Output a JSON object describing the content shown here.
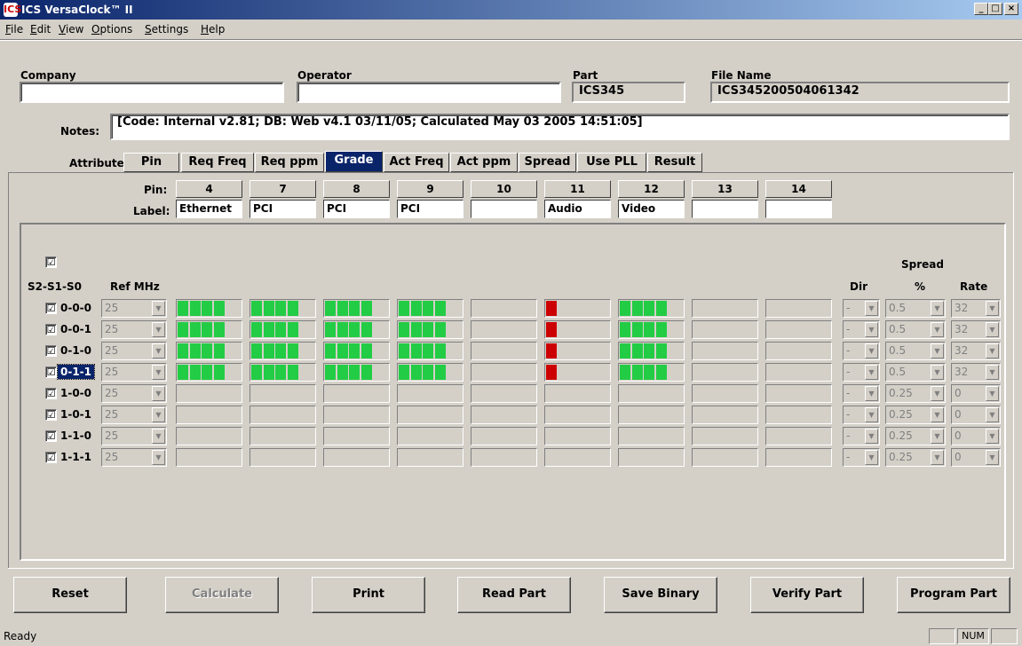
{
  "window": {
    "title": "ICS VersaClock™ II",
    "min": "_",
    "max": "□",
    "close": "×",
    "icon": "ICS"
  },
  "menu": [
    "File",
    "Edit",
    "View",
    "Options",
    "Settings",
    "Help"
  ],
  "header": {
    "company_label": "Company",
    "company_value": "",
    "operator_label": "Operator",
    "operator_value": "",
    "part_label": "Part",
    "part_value": "ICS345",
    "filename_label": "File Name",
    "filename_value": "ICS345200504061342",
    "notes_label": "Notes:",
    "notes_value": "[Code: Internal v2.81; DB: Web v4.1 03/11/05; Calculated May 03 2005 14:51:05]"
  },
  "attributes": {
    "label": "Attribute:",
    "tabs": [
      "Pin",
      "Req Freq",
      "Req ppm",
      "Grade",
      "Act Freq",
      "Act ppm",
      "Spread",
      "Use PLL",
      "Result"
    ],
    "active": "Grade"
  },
  "pins": {
    "pin_label": "Pin:",
    "label_label": "Label:",
    "numbers": [
      "4",
      "7",
      "8",
      "9",
      "10",
      "11",
      "12",
      "13",
      "14"
    ],
    "labels": [
      "Ethernet",
      "PCI",
      "PCI",
      "PCI",
      "",
      "Audio",
      "Video",
      "",
      ""
    ]
  },
  "grid": {
    "master_checkbox": "☑",
    "col_select": "S2-S1-S0",
    "col_ref": "Ref MHz",
    "col_dir": "Dir",
    "spread_header": "Spread",
    "col_pct": "%",
    "col_rate": "Rate",
    "colors": {
      "good": "#22cc44",
      "bad": "#cc0000"
    },
    "rows": [
      {
        "sel": "0-0-0",
        "ref": "25",
        "dir": "-",
        "pct": "0.5",
        "rate": "32",
        "grades": [
          4,
          4,
          4,
          4,
          0,
          -1,
          4,
          0,
          0
        ]
      },
      {
        "sel": "0-0-1",
        "ref": "25",
        "dir": "-",
        "pct": "0.5",
        "rate": "32",
        "grades": [
          4,
          4,
          4,
          4,
          0,
          -1,
          4,
          0,
          0
        ]
      },
      {
        "sel": "0-1-0",
        "ref": "25",
        "dir": "-",
        "pct": "0.5",
        "rate": "32",
        "grades": [
          4,
          4,
          4,
          4,
          0,
          -1,
          4,
          0,
          0
        ]
      },
      {
        "sel": "0-1-1",
        "ref": "25",
        "dir": "-",
        "pct": "0.5",
        "rate": "32",
        "grades": [
          4,
          4,
          4,
          4,
          0,
          -1,
          4,
          0,
          0
        ]
      },
      {
        "sel": "1-0-0",
        "ref": "25",
        "dir": "-",
        "pct": "0.25",
        "rate": "0",
        "grades": [
          0,
          0,
          0,
          0,
          0,
          0,
          0,
          0,
          0
        ]
      },
      {
        "sel": "1-0-1",
        "ref": "25",
        "dir": "-",
        "pct": "0.25",
        "rate": "0",
        "grades": [
          0,
          0,
          0,
          0,
          0,
          0,
          0,
          0,
          0
        ]
      },
      {
        "sel": "1-1-0",
        "ref": "25",
        "dir": "-",
        "pct": "0.25",
        "rate": "0",
        "grades": [
          0,
          0,
          0,
          0,
          0,
          0,
          0,
          0,
          0
        ]
      },
      {
        "sel": "1-1-1",
        "ref": "25",
        "dir": "-",
        "pct": "0.25",
        "rate": "0",
        "grades": [
          0,
          0,
          0,
          0,
          0,
          0,
          0,
          0,
          0
        ]
      }
    ]
  },
  "buttons": {
    "reset": "Reset",
    "calculate": "Calculate",
    "print": "Print",
    "read_part": "Read Part",
    "save_binary": "Save Binary",
    "verify_part": "Verify Part",
    "program_part": "Program Part"
  },
  "status": {
    "text": "Ready",
    "num": "NUM"
  }
}
